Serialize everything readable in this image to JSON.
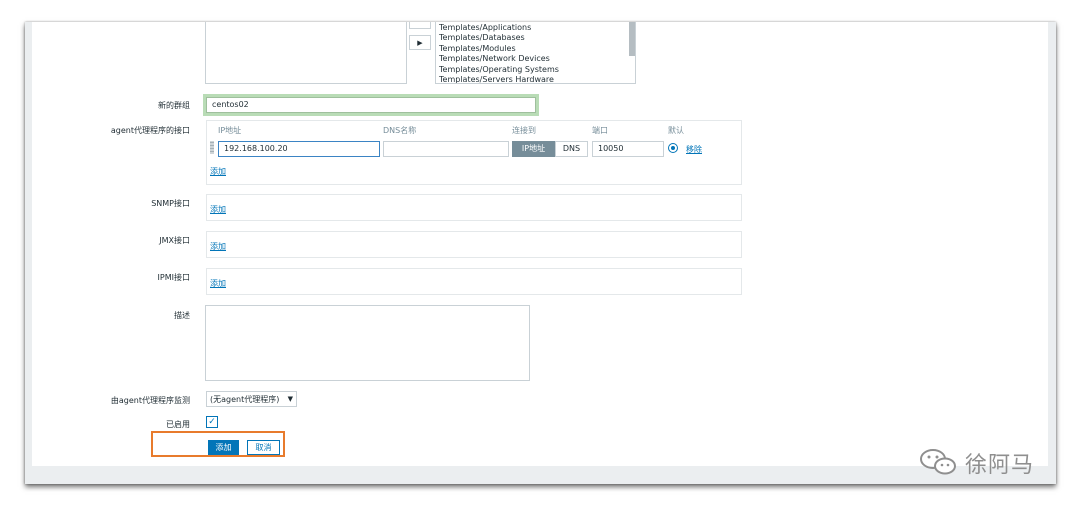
{
  "templates": {
    "list": [
      "Templates/Applications",
      "Templates/Databases",
      "Templates/Modules",
      "Templates/Network Devices",
      "Templates/Operating Systems",
      "Templates/Servers Hardware"
    ]
  },
  "new_group": {
    "label": "新的群组",
    "value": "centos02"
  },
  "agent_interface": {
    "label": "agent代理程序的接口",
    "headers": {
      "ip": "IP地址",
      "dns": "DNS名称",
      "connect": "连接到",
      "port": "端口",
      "default": "默认"
    },
    "row": {
      "ip": "192.168.100.20",
      "dns": "",
      "connect_ip": "IP地址",
      "connect_dns": "DNS",
      "port": "10050",
      "remove": "移除"
    },
    "add": "添加"
  },
  "snmp": {
    "label": "SNMP接口",
    "add": "添加"
  },
  "jmx": {
    "label": "JMX接口",
    "add": "添加"
  },
  "ipmi": {
    "label": "IPMI接口",
    "add": "添加"
  },
  "description": {
    "label": "描述",
    "value": ""
  },
  "monitored_by": {
    "label": "由agent代理程序监测",
    "selected": "(无agent代理程序)"
  },
  "enabled": {
    "label": "已启用"
  },
  "actions": {
    "add": "添加",
    "cancel": "取消"
  },
  "watermark": {
    "text": "徐阿马"
  },
  "colors": {
    "accent": "#0275b8",
    "highlight_green": "#b9dcb6",
    "highlight_orange": "#e87b2c"
  }
}
